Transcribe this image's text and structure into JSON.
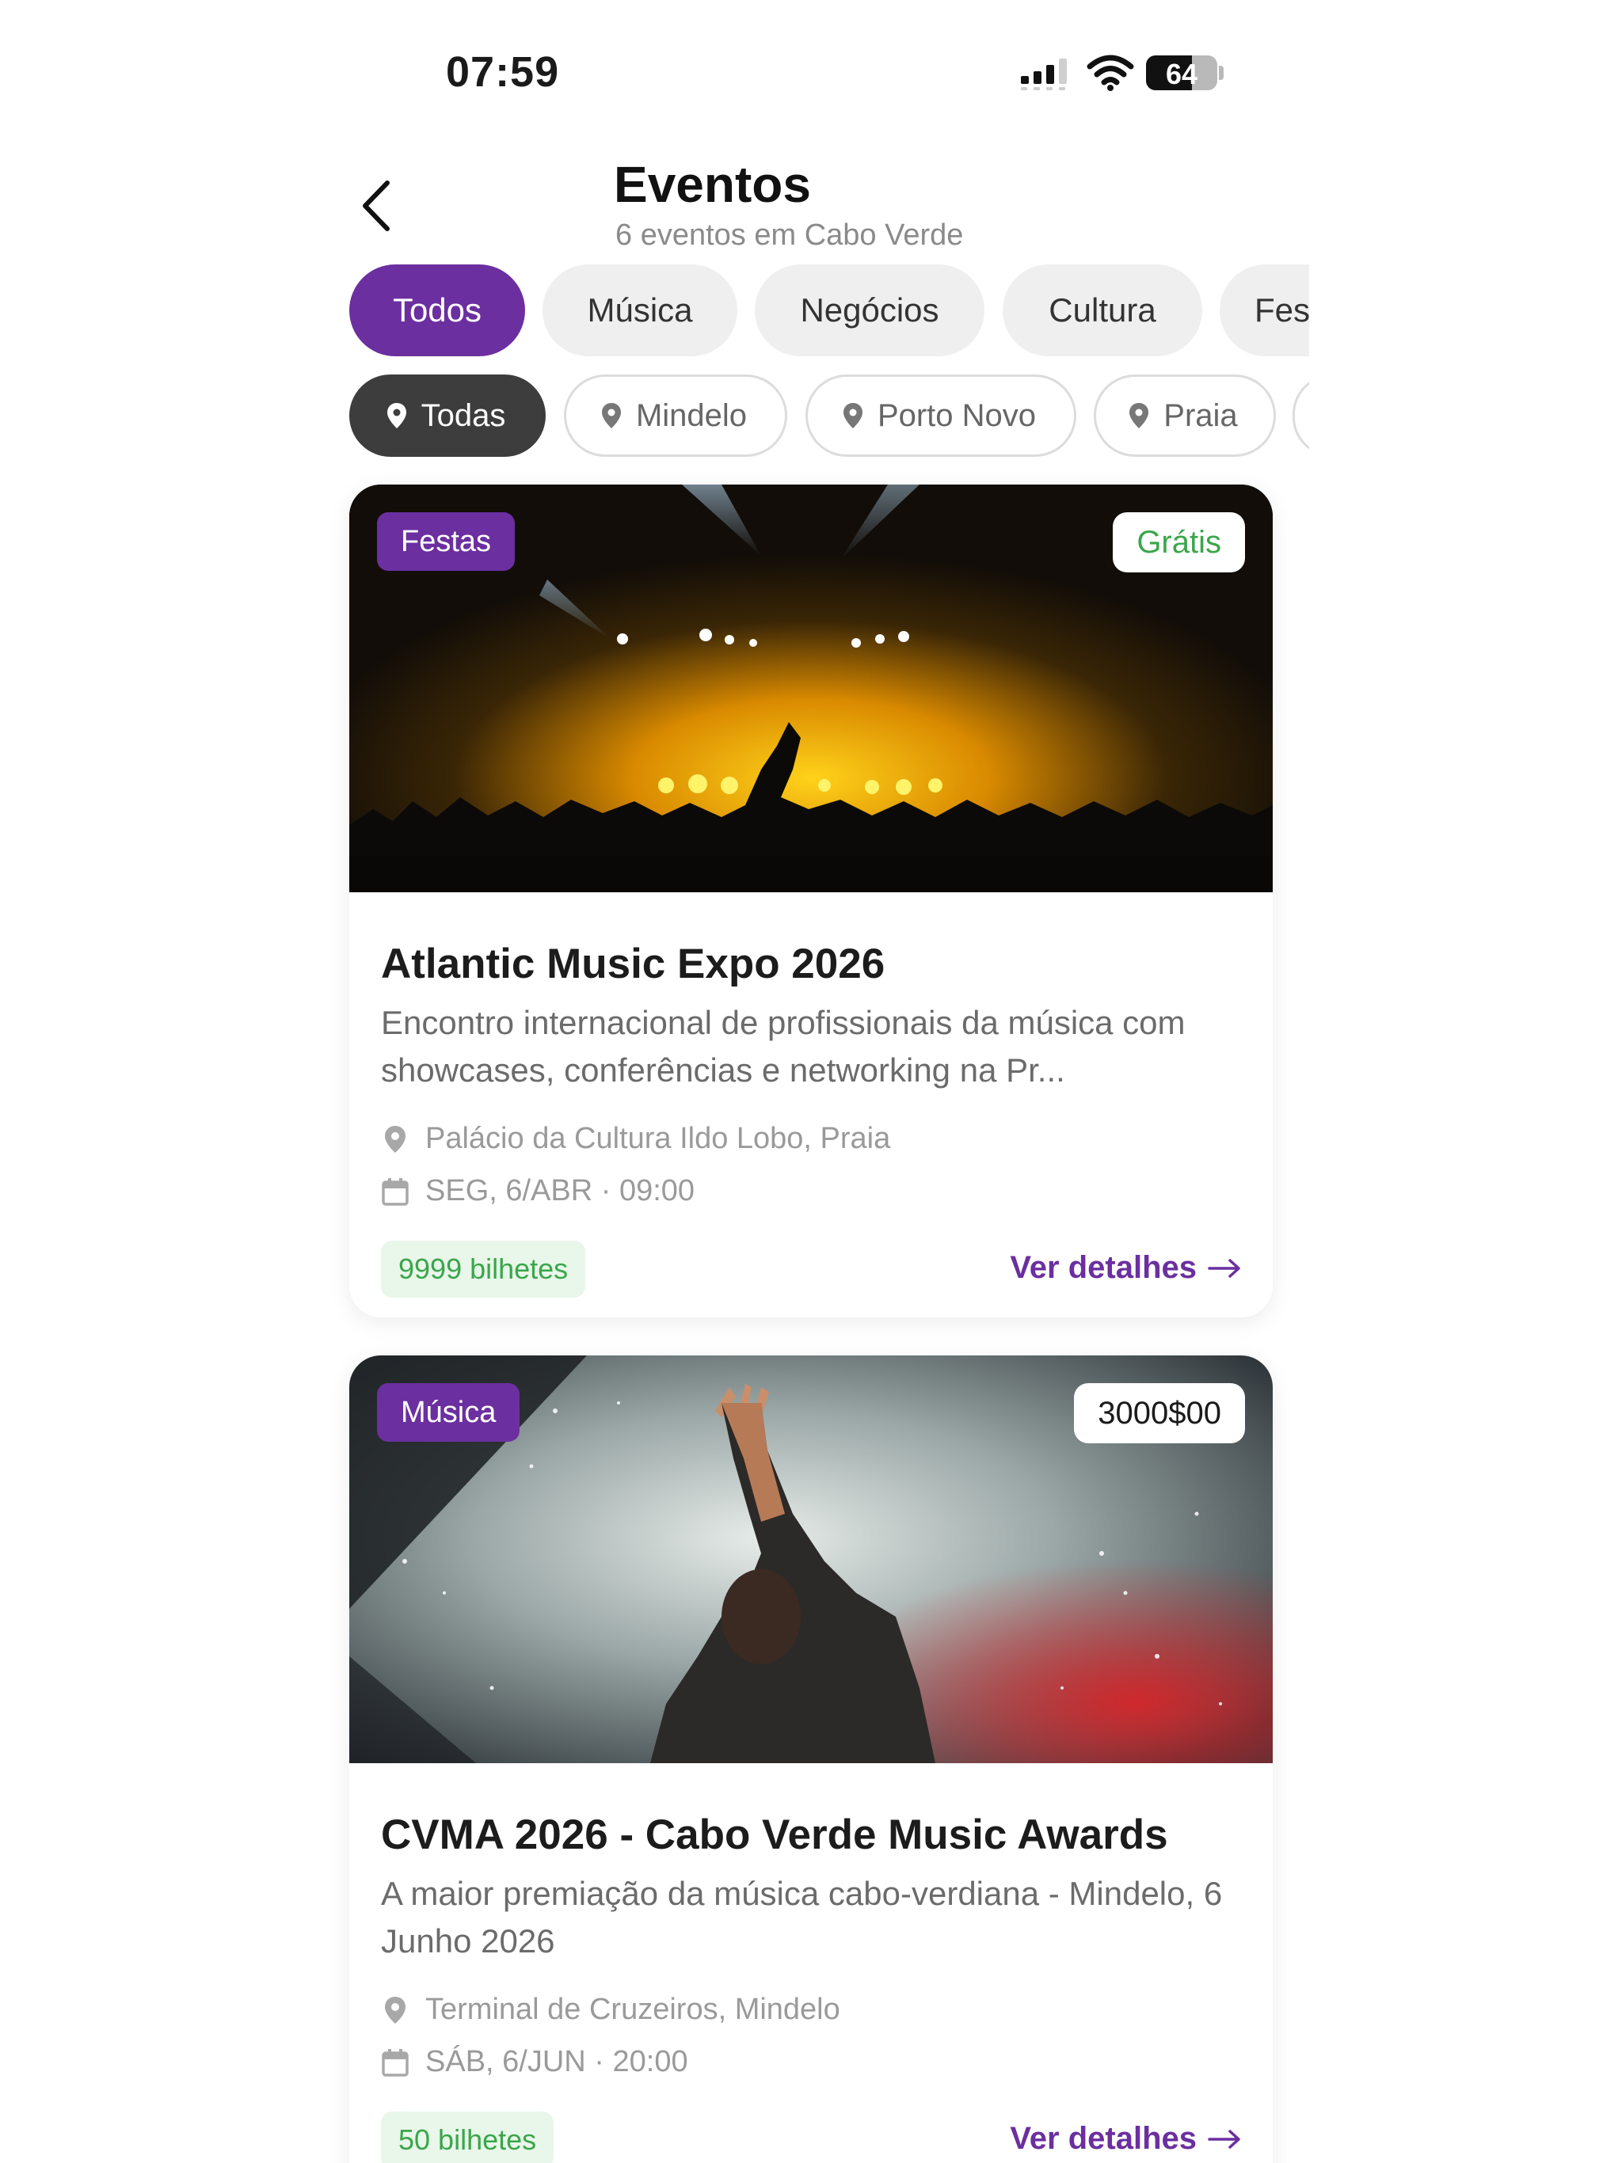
{
  "status_bar": {
    "time": "07:59",
    "battery": "64"
  },
  "header": {
    "title": "Eventos",
    "subtitle": "6 eventos em Cabo Verde"
  },
  "categories": [
    "Todos",
    "Música",
    "Negócios",
    "Cultura",
    "Fes"
  ],
  "cities": [
    "Todas",
    "Mindelo",
    "Porto Novo",
    "Praia"
  ],
  "events": [
    {
      "category": "Festas",
      "price": "Grátis",
      "title": "Atlantic Music Expo 2026",
      "description": "Encontro internacional de profissionais da música com showcases, conferências e networking na Pr...",
      "location": "Palácio da Cultura Ildo Lobo, Praia",
      "date": "SEG, 6/ABR · 09:00",
      "tickets": "9999 bilhetes",
      "details_label": "Ver detalhes"
    },
    {
      "category": "Música",
      "price": "3000$00",
      "title": "CVMA 2026 - Cabo Verde Music Awards",
      "description": "A maior premiação da música cabo-verdiana - Mindelo, 6 Junho 2026",
      "location": "Terminal de Cruzeiros, Mindelo",
      "date": "SÁB, 6/JUN · 20:00",
      "tickets": "50 bilhetes",
      "details_label": "Ver detalhes"
    }
  ],
  "colors": {
    "accent": "#6b2fa0",
    "free_green": "#3aa64a",
    "active_city_chip": "#3d3d3d",
    "chip_bg": "#efefef"
  },
  "icons": {
    "back": "chevron-left-icon",
    "location": "map-pin-icon",
    "date": "calendar-icon",
    "arrow": "arrow-right-icon"
  }
}
